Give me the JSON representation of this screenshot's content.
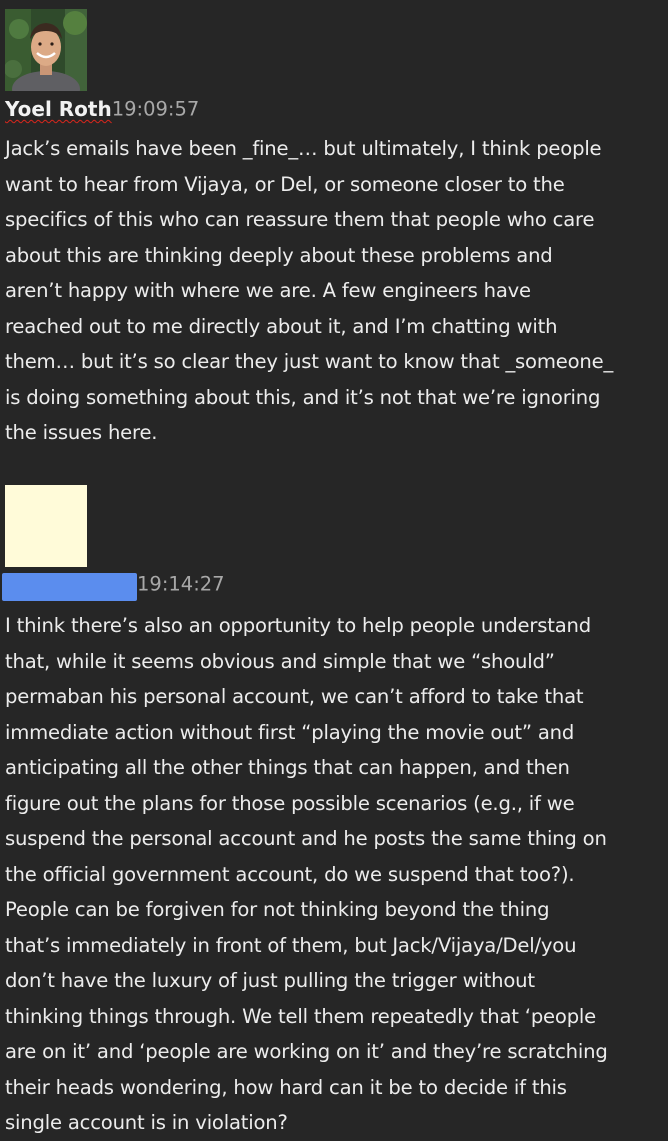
{
  "messages": [
    {
      "author": "Yoel Roth",
      "timestamp": "19:09:57",
      "author_redacted": false,
      "lines": [
        "Jack’s emails have been _fine_… but ultimately, I think people",
        "want to hear from Vijaya, or Del, or someone closer to the",
        "specifics of this who can reassure them that people who care",
        "about this are thinking deeply about these problems and",
        "aren’t happy with where we are. A few engineers have",
        "reached out to me directly about it, and I’m chatting with",
        "them… but it’s so clear they just want to know that _someone_",
        "is doing something about this, and it’s not that we’re ignoring",
        "the issues here."
      ]
    },
    {
      "author": "",
      "timestamp": "19:14:27",
      "author_redacted": true,
      "lines": [
        "I think there’s also an opportunity to help people understand",
        "that, while it seems obvious and simple that we “should”",
        "permaban his personal account, we can’t afford to take that",
        "immediate action without first “playing the movie out” and",
        "anticipating all the other things that can happen, and then",
        "figure out the plans for those possible scenarios (e.g., if we",
        "suspend the personal account and he posts the same thing on",
        "the official government account, do we suspend that too?).",
        "People can be forgiven for not thinking beyond the thing",
        "that’s immediately in front of them, but Jack/Vijaya/Del/you",
        "don’t have the luxury of just pulling the trigger without",
        "thinking things through. We tell them repeatedly that ‘people",
        "are on it’ and ‘people are working on it’ and they’re scratching",
        "their heads wondering, how hard can it be to decide if this",
        "single account is in violation?"
      ]
    }
  ],
  "colors": {
    "background": "#262626",
    "text": "#ececec",
    "timestamp": "#a8a8a8",
    "redaction_name": "#5b8dee",
    "redaction_avatar": "#fffbd9"
  }
}
